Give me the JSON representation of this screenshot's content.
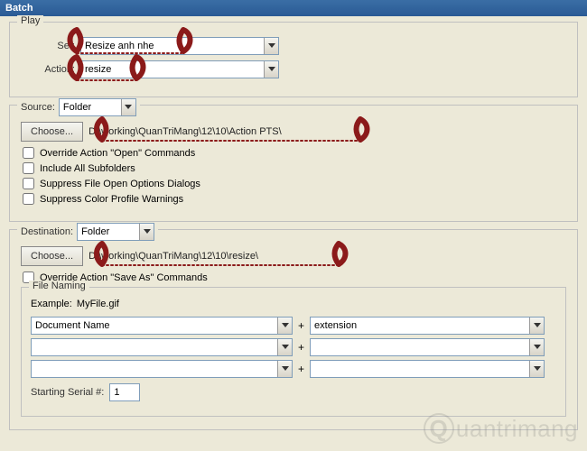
{
  "title": "Batch",
  "play": {
    "legend": "Play",
    "set_label": "Set:",
    "set_value": "Resize anh nhe",
    "action_label": "Action:",
    "action_value": "resize"
  },
  "source": {
    "legend_prefix": "Source:",
    "type": "Folder",
    "choose_btn": "Choose...",
    "path": "D:\\working\\QuanTriMang\\12\\10\\Action PTS\\",
    "cb_override": "Override Action \"Open\" Commands",
    "cb_subfolders": "Include All Subfolders",
    "cb_suppress_open": "Suppress File Open Options Dialogs",
    "cb_suppress_color": "Suppress Color Profile Warnings"
  },
  "dest": {
    "legend_prefix": "Destination:",
    "type": "Folder",
    "choose_btn": "Choose...",
    "path": "D:\\working\\QuanTriMang\\12\\10\\resize\\",
    "cb_override_save": "Override Action \"Save As\" Commands"
  },
  "naming": {
    "legend": "File Naming",
    "example_label": "Example:",
    "example_value": "MyFile.gif",
    "fields": [
      {
        "a": "Document Name",
        "b": "extension"
      },
      {
        "a": "",
        "b": ""
      },
      {
        "a": "",
        "b": ""
      }
    ],
    "serial_label": "Starting Serial #:",
    "serial_value": "1"
  },
  "watermark": "uantrimang",
  "watermark_q": "Q"
}
